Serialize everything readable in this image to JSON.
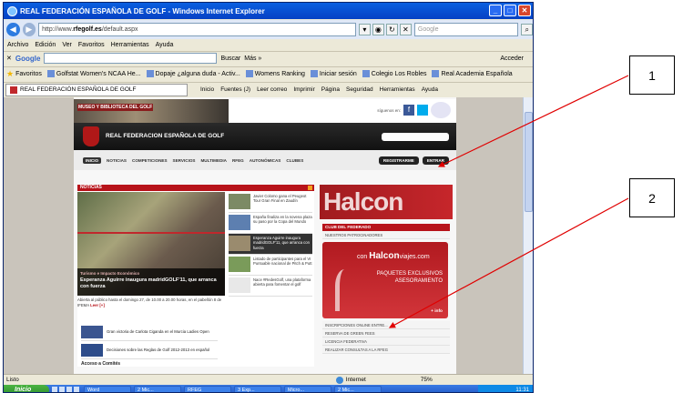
{
  "window": {
    "title": "REAL FEDERACIÓN ESPAÑOLA DE GOLF - Windows Internet Explorer",
    "url_prefix": "http://www.",
    "url_domain": "rfegolf.es",
    "url_suffix": "/default.aspx",
    "google_placeholder": "Google"
  },
  "menu": [
    "Archivo",
    "Edición",
    "Ver",
    "Favoritos",
    "Herramientas",
    "Ayuda"
  ],
  "google_bar": {
    "logo": "Google",
    "buscar": "Buscar",
    "mas": "Más »",
    "acceder": "Acceder"
  },
  "favorites": {
    "label": "Favoritos",
    "items": [
      "Golfstat Women's NCAA He...",
      "Dopaje ¿alguna duda - Activ...",
      "Womens Ranking",
      "Iniciar sesión",
      "Colegio Los Robles",
      "Real Academia Española"
    ]
  },
  "tab": {
    "label": "REAL FEDERACIÓN ESPAÑOLA DE GOLF"
  },
  "commands": [
    "Inicio",
    "Fuentes (J)",
    "Leer correo",
    "Imprimir",
    "Página",
    "Seguridad",
    "Herramientas",
    "Ayuda"
  ],
  "site": {
    "banner_text": "MUSEO Y BIBLIOTECA DEL GOLF",
    "social_label": "síguenos en:",
    "federation_name": "REAL FEDERACION ESPAÑOLA DE GOLF",
    "nav": [
      "INICIO",
      "NOTICIAS",
      "COMPETICIONES",
      "SERVICIOS",
      "MULTIMEDIA",
      "RFEG",
      "AUTONÓMICAS",
      "CLUBES"
    ],
    "nav_right": [
      "REGISTRARME",
      "ENTRAR"
    ],
    "news_section": "NOTICIAS",
    "main_category": "Turismo e Impacto Económico",
    "main_headline": "Esperanza Aguirre inaugura madridGOLF'11, que arranca con fuerza",
    "main_summary": "Abierta al público hasta el domingo 27, de 10.00 a 20.00 horas, en el pabellón 8 de IFEMA",
    "leer_mas": "Leer [+]",
    "side_items": [
      "Javier Colomo gana el Peugeot Tour Gran Final en Zaudín",
      "España finaliza en la novena plaza su paso por la Copa del Mundo",
      "Esperanza Aguirre inaugura madridGOLF'11, que arranca con fuerza",
      "Listado de participantes para el VI Puntuable nacional de Pitch & Putt",
      "Nace #RedesGolf, una plataforma abierta para fomentar el golf"
    ],
    "low_items": [
      "Gran victoria de Carlota Ciganda en el Murcia Ladies Open",
      "Decisiones sobre las Reglas de Golf 2012-2013 en español"
    ],
    "acceso": "Acceso a Comités",
    "halcon": "Halcon",
    "club_title": "CLUB DEL FEDERADO",
    "club_rows_top": [
      "NUESTROS PATROCINADORES"
    ],
    "ad": {
      "logo_small": "con",
      "logo_big": "Halcon",
      "logo_domain": "viajes.com",
      "headline1": "PAQUETES EXCLUSIVOS",
      "headline2": "ASESORAMIENTO",
      "info": "+ info"
    },
    "club_rows_bottom": [
      "INSCRIPCIONES ONLINE ENTRE...",
      "RESERVA DE GREEN FEES",
      "LICENCIA FEDERATIVA",
      "REALIZAR CONSULTAS A LA RFEG"
    ]
  },
  "status": {
    "left": "Listo",
    "zone": "Internet",
    "zoom": "75%"
  },
  "taskbar": {
    "start": "Inicio",
    "tasks": [
      "Word",
      "2 Mic...",
      "RFEG",
      "3 Exp...",
      "Micro...",
      "2 Mic..."
    ],
    "clock": "11:31"
  },
  "callouts": [
    "1",
    "2"
  ],
  "colors": {
    "accent_red": "#b7131a",
    "arrow": "#e00000",
    "ie_blue": "#0a5fe0"
  }
}
